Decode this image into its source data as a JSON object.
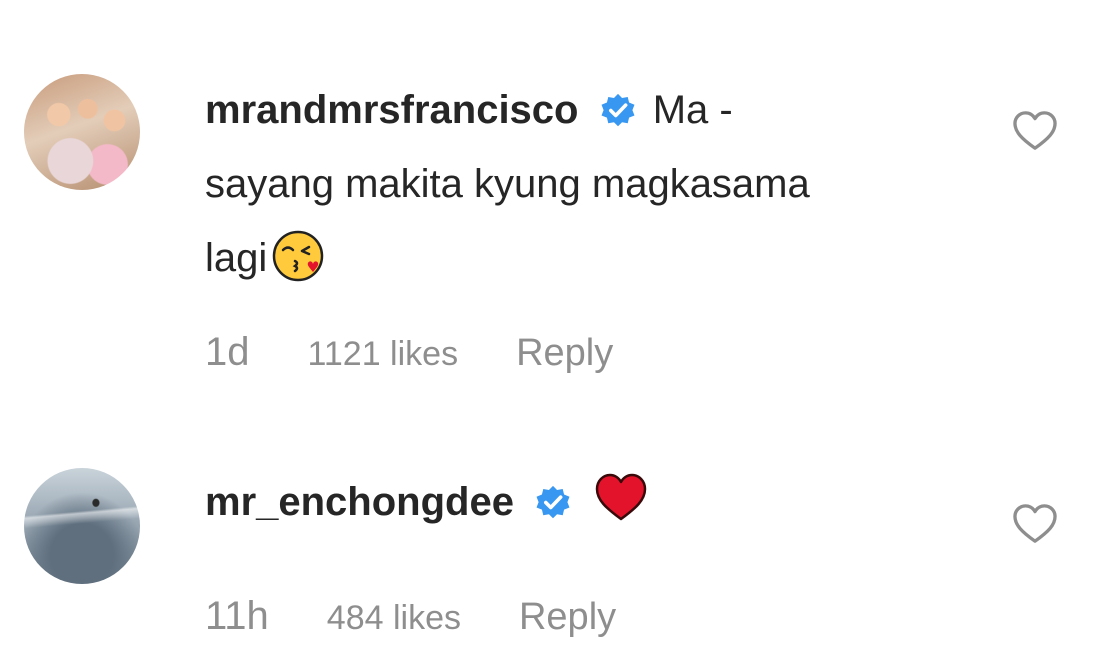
{
  "comments": [
    {
      "username": "mrandmrsfrancisco",
      "verified": true,
      "text_line1": "Ma -",
      "text_line2": "sayang makita kyung magkasama",
      "text_line3": "lagi",
      "emoji": "kissing-face-emoji",
      "age": "1d",
      "likes": "1121 likes",
      "reply": "Reply"
    },
    {
      "username": "mr_enchongdee",
      "verified": true,
      "emoji": "red-heart-emoji",
      "age": "11h",
      "likes": "484 likes",
      "reply": "Reply"
    }
  ],
  "colors": {
    "text": "#262626",
    "meta": "#8e8e8e",
    "verified_badge": "#3897f0",
    "heart_emoji": "#e3132b"
  },
  "icons": [
    "verified-badge-icon",
    "like-heart-outline-icon"
  ]
}
